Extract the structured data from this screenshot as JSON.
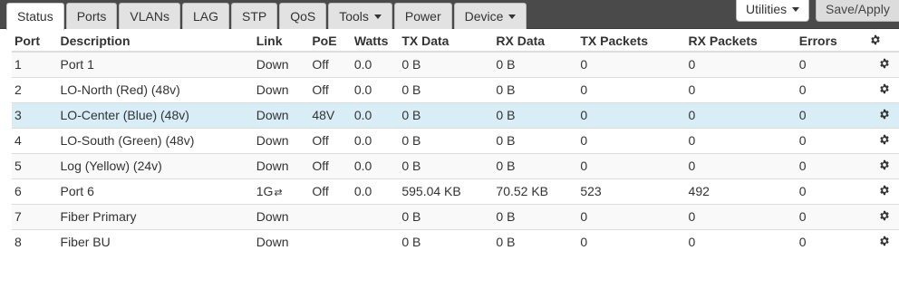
{
  "tabs": [
    {
      "label": "Status",
      "active": true
    },
    {
      "label": "Ports"
    },
    {
      "label": "VLANs"
    },
    {
      "label": "LAG"
    },
    {
      "label": "STP"
    },
    {
      "label": "QoS"
    },
    {
      "label": "Tools",
      "dropdown": true
    },
    {
      "label": "Power"
    },
    {
      "label": "Device",
      "dropdown": true
    }
  ],
  "toolbar": {
    "utilities_label": "Utilities",
    "save_label": "Save/Apply"
  },
  "table": {
    "headers": [
      "Port",
      "Description",
      "Link",
      "PoE",
      "Watts",
      "TX Data",
      "RX Data",
      "TX Packets",
      "RX Packets",
      "Errors"
    ],
    "rows": [
      {
        "port": "1",
        "description": "Port 1",
        "link": "Down",
        "poe": "Off",
        "watts": "0.0",
        "tx_data": "0 B",
        "rx_data": "0 B",
        "tx_packets": "0",
        "rx_packets": "0",
        "errors": "0"
      },
      {
        "port": "2",
        "description": "LO-North (Red) (48v)",
        "link": "Down",
        "poe": "Off",
        "watts": "0.0",
        "tx_data": "0 B",
        "rx_data": "0 B",
        "tx_packets": "0",
        "rx_packets": "0",
        "errors": "0"
      },
      {
        "port": "3",
        "description": "LO-Center (Blue) (48v)",
        "link": "Down",
        "poe": "48V",
        "watts": "0.0",
        "tx_data": "0 B",
        "rx_data": "0 B",
        "tx_packets": "0",
        "rx_packets": "0",
        "errors": "0"
      },
      {
        "port": "4",
        "description": "LO-South (Green) (48v)",
        "link": "Down",
        "poe": "Off",
        "watts": "0.0",
        "tx_data": "0 B",
        "rx_data": "0 B",
        "tx_packets": "0",
        "rx_packets": "0",
        "errors": "0"
      },
      {
        "port": "5",
        "description": "Log (Yellow) (24v)",
        "link": "Down",
        "poe": "Off",
        "watts": "0.0",
        "tx_data": "0 B",
        "rx_data": "0 B",
        "tx_packets": "0",
        "rx_packets": "0",
        "errors": "0"
      },
      {
        "port": "6",
        "description": "Port 6",
        "link": "1G",
        "poe": "Off",
        "watts": "0.0",
        "tx_data": "595.04 KB",
        "rx_data": "70.52 KB",
        "tx_packets": "523",
        "rx_packets": "492",
        "errors": "0"
      },
      {
        "port": "7",
        "description": "Fiber Primary",
        "link": "Down",
        "poe": "",
        "watts": "",
        "tx_data": "0 B",
        "rx_data": "0 B",
        "tx_packets": "0",
        "rx_packets": "0",
        "errors": "0"
      },
      {
        "port": "8",
        "description": "Fiber BU",
        "link": "Down",
        "poe": "",
        "watts": "",
        "tx_data": "0 B",
        "rx_data": "0 B",
        "tx_packets": "0",
        "rx_packets": "0",
        "errors": "0"
      }
    ]
  },
  "colors": {
    "topbar": "#4a4a4a",
    "selected_row": "#d9edf7",
    "poe_active": "#f0a030"
  }
}
